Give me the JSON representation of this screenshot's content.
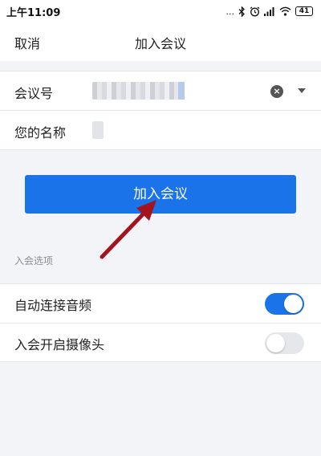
{
  "status_bar": {
    "time": "上午11:09",
    "icons": [
      "dots-icon",
      "bluetooth-icon",
      "alarm-icon",
      "signal-icon",
      "wifi-icon"
    ],
    "dots": "...",
    "battery": "41"
  },
  "nav": {
    "cancel_label": "取消",
    "title": "加入会议"
  },
  "form": {
    "meeting_id_label": "会议号",
    "name_label": "您的名称"
  },
  "join_button_label": "加入会议",
  "options_section": {
    "title": "入会选项",
    "items": [
      {
        "label": "自动连接音频",
        "enabled": true
      },
      {
        "label": "入会开启摄像头",
        "enabled": false
      }
    ]
  },
  "colors": {
    "accent": "#1a73e8",
    "arrow": "#a3141e",
    "background": "#f3f4f8"
  }
}
